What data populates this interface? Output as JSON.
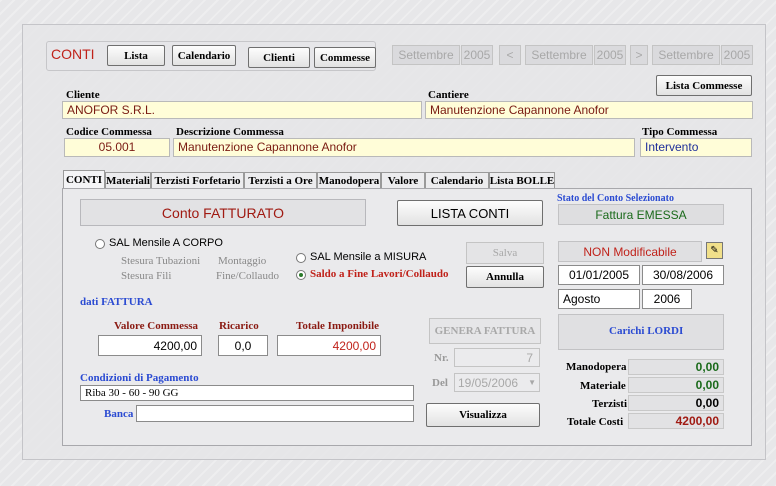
{
  "header": {
    "conti": "CONTI",
    "lista": "Lista",
    "calendario": "Calendario",
    "clienti": "Clienti",
    "commesse": "Commesse",
    "month1": "Settembre",
    "year1": "2005",
    "prev": "<",
    "month2": "Settembre",
    "year2": "2005",
    "next": ">",
    "month3": "Settembre",
    "year3": "2005",
    "lista_commesse": "Lista Commesse"
  },
  "info": {
    "cliente_label": "Cliente",
    "cliente_value": "ANOFOR S.R.L.",
    "cantiere_label": "Cantiere",
    "cantiere_value": "Manutenzione Capannone Anofor",
    "codice_label": "Codice Commessa",
    "codice_value": "05.001",
    "descrizione_label": "Descrizione Commessa",
    "descrizione_value": "Manutenzione Capannone Anofor",
    "tipo_label": "Tipo Commessa",
    "tipo_value": "Intervento"
  },
  "tabs": [
    "CONTI",
    "Materiali",
    "Terzisti Forfetario",
    "Terzisti a Ore",
    "Manodopera",
    "Valore",
    "Calendario",
    "Lista BOLLE"
  ],
  "conto": {
    "status_title": "Conto FATTURATO",
    "lista_conti": "LISTA CONTI",
    "stato_label": "Stato del Conto Selezionato",
    "stato_value": "Fattura EMESSA",
    "sal_corpo": "SAL Mensile A CORPO",
    "stesura_tubazioni": "Stesura Tubazioni",
    "montaggio": "Montaggio",
    "stesura_fili": "Stesura Fili",
    "fine_collaudo": "Fine/Collaudo",
    "sal_misura": "SAL Mensile a MISURA",
    "saldo_fine": "Saldo a Fine Lavori/Collaudo",
    "salva": "Salva",
    "annulla": "Annulla",
    "non_modificabile": "NON Modificabile",
    "date_from": "01/01/2005",
    "date_to": "30/08/2006",
    "month": "Agosto",
    "year": "2006",
    "dati_fattura": "dati FATTURA",
    "valore_label": "Valore Commessa",
    "valore_value": "4200,00",
    "ricarico_label": "Ricarico",
    "ricarico_value": "0,0",
    "totale_imponibile_label": "Totale Imponibile",
    "totale_imponibile_value": "4200,00",
    "genera_fattura": "GENERA FATTURA",
    "nr_label": "Nr.",
    "nr_value": "7",
    "del_label": "Del",
    "del_value": "19/05/2006",
    "carichi": "Carichi LORDI",
    "condizioni_label": "Condizioni di Pagamento",
    "condizioni_value": "Riba 30 - 60 - 90 GG",
    "banca_label": "Banca",
    "banca_value": "",
    "visualizza": "Visualizza"
  },
  "totals": {
    "manodopera_label": "Manodopera",
    "manodopera_value": "0,00",
    "materiale_label": "Materiale",
    "materiale_value": "0,00",
    "terzisti_label": "Terzisti",
    "terzisti_value": "0,00",
    "totale_label": "Totale Costi",
    "totale_value": "4200,00"
  },
  "colors": {
    "accent_red": "#c0221a",
    "link_blue": "#2b4bd2",
    "value_green": "#1a6a1a",
    "field_yellow": "#fffdd8"
  }
}
